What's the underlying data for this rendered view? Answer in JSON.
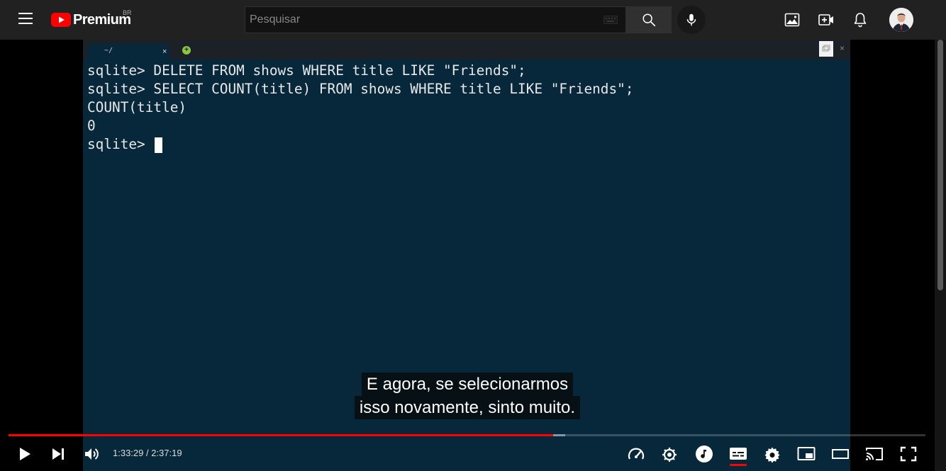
{
  "header": {
    "logo_text": "Premium",
    "country_code": "BR",
    "search_placeholder": "Pesquisar"
  },
  "icons": [
    "menu-icon",
    "youtube-logo-icon",
    "keyboard-icon",
    "search-icon",
    "mic-icon",
    "image-icon",
    "create-video-icon",
    "bell-icon",
    "avatar",
    "play-icon",
    "next-icon",
    "volume-icon",
    "speed-icon",
    "settings-icon",
    "music-icon",
    "subtitles-icon",
    "settings-gear-icon",
    "miniplayer-icon",
    "theater-icon",
    "cast-icon",
    "fullscreen-icon"
  ],
  "colors": {
    "brand_red": "#ff0000",
    "terminal_bg": "#06283a"
  },
  "terminal": {
    "tab_label": "~/",
    "lines": [
      "sqlite> DELETE FROM shows WHERE title LIKE \"Friends\";",
      "sqlite> SELECT COUNT(title) FROM shows WHERE title LIKE \"Friends\";",
      "COUNT(title)",
      "0",
      "sqlite> "
    ]
  },
  "captions": {
    "line1": "E agora, se selecionarmos",
    "line2": "isso novamente, sinto muito."
  },
  "player": {
    "time_display": "1:33:29 / 2:37:19",
    "played_fraction": 0.594,
    "loaded_fraction": 0.607
  }
}
